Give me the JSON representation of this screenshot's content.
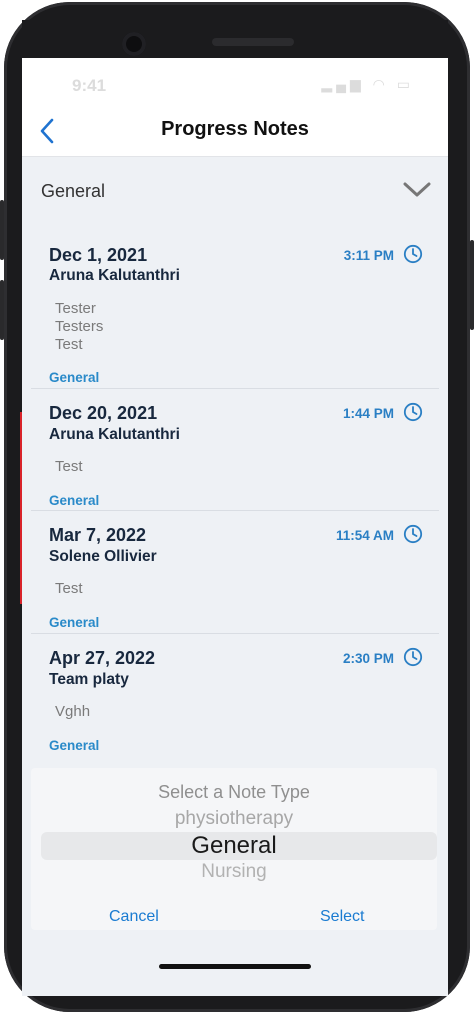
{
  "status": {
    "time": "9:41",
    "icons": "▂▄▆ ◠ ▭"
  },
  "nav": {
    "title": "Progress Notes",
    "back_icon": "chevron-left-icon"
  },
  "filter": {
    "selected": "General",
    "icon": "chevron-down-icon"
  },
  "notes": [
    {
      "date": "Dec 1, 2021",
      "author": "Aruna Kalutanthri",
      "time": "3:11 PM",
      "lines": [
        "Tester",
        "Testers",
        "Test"
      ],
      "type": "General"
    },
    {
      "date": "Dec 20, 2021",
      "author": "Aruna Kalutanthri",
      "time": "1:44 PM",
      "lines": [
        "Test"
      ],
      "type": "General"
    },
    {
      "date": "Mar 7, 2022",
      "author": "Solene Ollivier",
      "time": "11:54 AM",
      "lines": [
        "Test"
      ],
      "type": "General"
    },
    {
      "date": "Apr 27, 2022",
      "author": "Team platy",
      "time": "2:30 PM",
      "lines": [
        "Vghh"
      ],
      "type": "General"
    }
  ],
  "picker": {
    "title": "Select a Note Type",
    "options": [
      "physiotherapy",
      "General",
      "Nursing"
    ],
    "selected": "General",
    "cancel_label": "Cancel",
    "select_label": "Select"
  },
  "colors": {
    "accent": "#2a7fc4",
    "heading": "#18283e",
    "body_text": "#7a7a7a"
  }
}
